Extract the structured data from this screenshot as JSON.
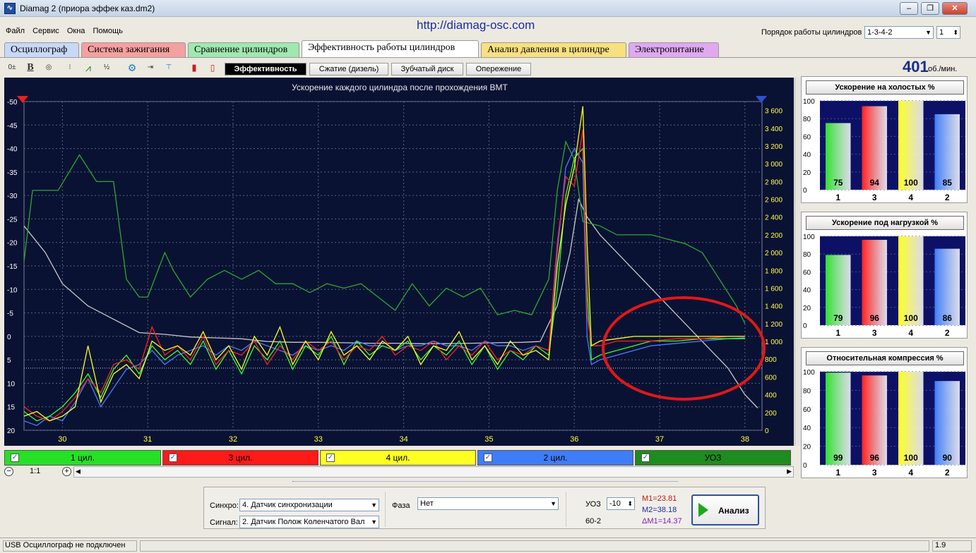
{
  "window": {
    "title": "Diamag 2 (приора эффек каз.dm2)",
    "url": "http://diamag-osc.com",
    "icon": "oscilloscope-app-icon"
  },
  "menu": [
    "Файл",
    "Сервис",
    "Окна",
    "Помощь"
  ],
  "firing_order": {
    "label": "Порядок работы цилиндров",
    "value": "1-3-4-2",
    "spin_value": "1"
  },
  "tabs": [
    {
      "label": "Осциллограф",
      "color": "#c8d8f8"
    },
    {
      "label": "Система зажигания",
      "color": "#f5a0a0"
    },
    {
      "label": "Сравнение цилиндров",
      "color": "#a0e8b0"
    },
    {
      "label": "Эффективность работы цилиндров",
      "color": "#ffffff",
      "active": true
    },
    {
      "label": "Анализ давления в цилиндре",
      "color": "#f8e080"
    },
    {
      "label": "Электропитание",
      "color": "#e0a8f0"
    }
  ],
  "subtabs": [
    "Эффективность",
    "Сжатие (дизель)",
    "Зубчатый диск",
    "Опережение"
  ],
  "rpm": {
    "value": "401",
    "unit": "об./мин."
  },
  "chart_data": {
    "type": "line",
    "title": "Ускорение каждого цилиндра после прохождения ВМТ",
    "x_ticks": [
      "30",
      "31",
      "32",
      "33",
      "34",
      "35",
      "36",
      "37",
      "38"
    ],
    "xlim": [
      29.55,
      38.2
    ],
    "left_ticks": [
      "-50",
      "-45",
      "-40",
      "-35",
      "-30",
      "-25",
      "-20",
      "-15",
      "-10",
      "-5",
      "0",
      "5",
      "10",
      "15",
      "20"
    ],
    "ylim_left": [
      -50,
      20
    ],
    "right_ticks": [
      "3 600",
      "3 400",
      "3 200",
      "3 000",
      "2 800",
      "2 600",
      "2 400",
      "2 200",
      "2 000",
      "1 800",
      "1 600",
      "1 400",
      "1 200",
      "1 000",
      "800",
      "600",
      "400",
      "200",
      "0"
    ],
    "ylim_right": [
      0,
      3700
    ],
    "series": [
      {
        "name": "1 цил.",
        "color": "#33ff33",
        "x": [
          29.55,
          29.7,
          29.85,
          30.0,
          30.15,
          30.3,
          30.45,
          30.6,
          30.75,
          30.9,
          31.05,
          31.2,
          31.35,
          31.5,
          31.65,
          31.8,
          31.95,
          32.1,
          32.25,
          32.4,
          32.55,
          32.7,
          32.85,
          33.0,
          33.15,
          33.3,
          33.45,
          33.6,
          33.75,
          33.9,
          34.05,
          34.2,
          34.35,
          34.5,
          34.65,
          34.8,
          34.95,
          35.1,
          35.25,
          35.4,
          35.55,
          35.7,
          35.8,
          35.9,
          36.0,
          36.1,
          36.15,
          36.2,
          36.3,
          36.5,
          36.7,
          36.9,
          37.2,
          37.5,
          37.8,
          38.0
        ],
        "y": [
          16,
          18,
          17,
          15,
          12,
          8,
          13,
          7,
          4,
          8,
          2,
          5,
          3,
          6,
          1,
          7,
          3,
          8,
          2,
          5,
          1,
          7,
          2,
          4,
          0,
          6,
          1,
          4,
          2,
          3,
          1,
          5,
          2,
          4,
          1,
          6,
          2,
          7,
          3,
          5,
          2,
          4,
          -10,
          -30,
          -38,
          -40,
          -10,
          5,
          4,
          3,
          2,
          1,
          1,
          0.5,
          0.5,
          0.5
        ]
      },
      {
        "name": "3 цил.",
        "color": "#ff2020",
        "x": [
          29.55,
          29.7,
          29.85,
          30.0,
          30.15,
          30.3,
          30.45,
          30.6,
          30.75,
          30.9,
          31.05,
          31.2,
          31.35,
          31.5,
          31.65,
          31.8,
          31.95,
          32.1,
          32.25,
          32.4,
          32.55,
          32.7,
          32.85,
          33.0,
          33.15,
          33.3,
          33.45,
          33.6,
          33.75,
          33.9,
          34.05,
          34.2,
          34.35,
          34.5,
          34.65,
          34.8,
          34.95,
          35.1,
          35.25,
          35.4,
          35.55,
          35.7,
          35.8,
          35.9,
          36.0,
          36.1,
          36.15,
          36.2,
          36.3,
          36.5,
          36.7,
          36.9,
          37.2,
          37.5,
          37.8,
          38.0
        ],
        "y": [
          15,
          17,
          18,
          16,
          13,
          9,
          12,
          6,
          5,
          7,
          -2,
          4,
          2,
          5,
          0,
          6,
          3,
          4,
          1,
          6,
          2,
          5,
          1,
          3,
          1,
          5,
          2,
          3,
          0,
          4,
          2,
          3,
          1,
          5,
          2,
          4,
          1,
          5,
          3,
          4,
          2,
          3,
          -20,
          -34,
          -32,
          -44,
          -5,
          2,
          2,
          1,
          1,
          1,
          0.5,
          0.5,
          0,
          0
        ]
      },
      {
        "name": "4 цил.",
        "color": "#ffff20",
        "x": [
          29.55,
          29.7,
          29.85,
          30.0,
          30.15,
          30.3,
          30.45,
          30.6,
          30.75,
          30.9,
          31.05,
          31.2,
          31.35,
          31.5,
          31.65,
          31.8,
          31.95,
          32.1,
          32.25,
          32.4,
          32.55,
          32.7,
          32.85,
          33.0,
          33.15,
          33.3,
          33.45,
          33.6,
          33.75,
          33.9,
          34.05,
          34.2,
          34.35,
          34.5,
          34.65,
          34.8,
          34.95,
          35.1,
          35.25,
          35.4,
          35.55,
          35.7,
          35.8,
          35.9,
          36.0,
          36.1,
          36.15,
          36.2,
          36.3,
          36.5,
          36.7,
          36.9,
          37.2,
          37.5,
          37.8,
          38.0
        ],
        "y": [
          17,
          16,
          18,
          17,
          15,
          2,
          14,
          8,
          6,
          9,
          1,
          3,
          2,
          4,
          -1,
          5,
          2,
          7,
          0,
          4,
          -2,
          6,
          1,
          5,
          -1,
          4,
          2,
          5,
          1,
          3,
          0,
          6,
          2,
          3,
          -1,
          5,
          2,
          6,
          1,
          4,
          3,
          5,
          -15,
          -28,
          -36,
          -49,
          -20,
          2,
          1,
          0.5,
          0,
          0,
          0,
          0,
          0,
          0
        ]
      },
      {
        "name": "2 цил.",
        "color": "#4a7cff",
        "x": [
          29.55,
          29.7,
          29.85,
          30.0,
          30.15,
          30.3,
          30.45,
          30.6,
          30.75,
          30.9,
          31.05,
          31.2,
          31.35,
          31.5,
          31.65,
          31.8,
          31.95,
          32.1,
          32.25,
          32.4,
          32.55,
          32.7,
          32.85,
          33.0,
          33.15,
          33.3,
          33.45,
          33.6,
          33.75,
          33.9,
          34.05,
          34.2,
          34.35,
          34.5,
          34.65,
          34.8,
          34.95,
          35.1,
          35.25,
          35.4,
          35.55,
          35.7,
          35.8,
          35.9,
          36.0,
          36.1,
          36.15,
          36.2,
          36.3,
          36.5,
          36.7,
          36.9,
          37.2,
          37.5,
          37.8,
          38.0
        ],
        "y": [
          18,
          19,
          17,
          18,
          14,
          9,
          15,
          11,
          7,
          6,
          3,
          6,
          4,
          3,
          2,
          4,
          2,
          3,
          1,
          2,
          3,
          4,
          2,
          3,
          2,
          3,
          1,
          2,
          2,
          3,
          2,
          2,
          1,
          2,
          2,
          3,
          1,
          2,
          2,
          3,
          2,
          3,
          -18,
          -36,
          -40,
          -37,
          0,
          6,
          5,
          4,
          3,
          2,
          1.5,
          1,
          0.5,
          0.3
        ]
      },
      {
        "name": "УОЗ",
        "color": "#2ea82e",
        "x": [
          29.55,
          29.65,
          29.9,
          29.95,
          30.2,
          30.4,
          30.6,
          30.75,
          30.9,
          31.0,
          31.2,
          31.3,
          31.5,
          31.7,
          31.9,
          32.1,
          32.3,
          32.5,
          32.7,
          32.9,
          33.1,
          33.3,
          33.5,
          33.7,
          33.9,
          34.1,
          34.3,
          34.5,
          34.7,
          34.9,
          35.1,
          35.3,
          35.5,
          35.6,
          35.7,
          35.8,
          35.9,
          36.0,
          36.1,
          36.3,
          36.5,
          36.7,
          36.9,
          37.1,
          37.3,
          37.5,
          37.7,
          37.9,
          38.0
        ],
        "y": [
          1900,
          2700,
          2700,
          2700,
          3100,
          2800,
          2800,
          1700,
          1500,
          1500,
          2000,
          1800,
          1500,
          1700,
          1800,
          1700,
          1800,
          1650,
          1650,
          1550,
          1650,
          1600,
          1650,
          1500,
          1350,
          1650,
          1400,
          1600,
          1500,
          1600,
          1300,
          1350,
          1300,
          1500,
          1700,
          2700,
          3250,
          3050,
          2350,
          2300,
          2200,
          2200,
          2200,
          2150,
          2100,
          2000,
          1700,
          1400,
          1200
        ]
      },
      {
        "name": "",
        "color": "#c8c8c8",
        "x": [
          29.55,
          29.8,
          30.0,
          30.3,
          30.6,
          30.9,
          31.2,
          31.5,
          31.8,
          32.1,
          32.4,
          32.7,
          33.0,
          33.3,
          33.6,
          33.9,
          34.2,
          34.5,
          34.8,
          35.1,
          35.4,
          35.6,
          35.8,
          35.95,
          36.05,
          36.15,
          36.3,
          36.6,
          36.9,
          37.2,
          37.5,
          37.8,
          38.0,
          38.15
        ],
        "y": [
          2300,
          2000,
          1650,
          1400,
          1250,
          1100,
          1080,
          1050,
          1040,
          1030,
          1000,
          990,
          990,
          985,
          980,
          980,
          975,
          975,
          980,
          985,
          990,
          1000,
          1400,
          2000,
          2600,
          2400,
          2200,
          1900,
          1600,
          1300,
          1000,
          700,
          400,
          250
        ]
      }
    ],
    "marker_line_right": 700
  },
  "legend": [
    {
      "label": "1 цил.",
      "color": "#26e026"
    },
    {
      "label": "3 цил.",
      "color": "#ff1a1a"
    },
    {
      "label": "4 цил.",
      "color": "#ffff22"
    },
    {
      "label": "2 цил.",
      "color": "#3f7cf7"
    },
    {
      "label": "УОЗ",
      "color": "#1e8c1e"
    }
  ],
  "zoom": {
    "label": "1:1"
  },
  "bar_panels": [
    {
      "title": "Ускорение на холостых %",
      "ticks": [
        "100",
        "80",
        "60",
        "40",
        "20",
        "0"
      ],
      "bars": [
        {
          "cyl": "1",
          "value": 75,
          "color": "#2ee02e"
        },
        {
          "cyl": "3",
          "value": 94,
          "color": "#ff2020"
        },
        {
          "cyl": "4",
          "value": 100,
          "color": "#ffff22"
        },
        {
          "cyl": "2",
          "value": 85,
          "color": "#3f7cf7"
        }
      ],
      "value_labels": true
    },
    {
      "title": "Ускорение под нагрузкой %",
      "ticks": [
        "100",
        "80",
        "60",
        "40",
        "20",
        "0"
      ],
      "bars": [
        {
          "cyl": "1",
          "value": 79,
          "color": "#2ee02e"
        },
        {
          "cyl": "3",
          "value": 96,
          "color": "#ff2020"
        },
        {
          "cyl": "4",
          "value": 100,
          "color": "#ffff22"
        },
        {
          "cyl": "2",
          "value": 86,
          "color": "#3f7cf7"
        }
      ],
      "value_labels": true
    },
    {
      "title": "Относительная компрессия %",
      "ticks": [
        "100",
        "80",
        "60",
        "40",
        "20",
        "0"
      ],
      "bars": [
        {
          "cyl": "1",
          "value": 99,
          "color": "#2ee02e"
        },
        {
          "cyl": "3",
          "value": 96,
          "color": "#ff2020"
        },
        {
          "cyl": "4",
          "value": 100,
          "color": "#ffff22"
        },
        {
          "cyl": "2",
          "value": 90,
          "color": "#3f7cf7"
        }
      ],
      "value_labels": true
    }
  ],
  "bottom": {
    "sync_label": "Синхро:",
    "sync_value": "4. Датчик синхронизации",
    "signal_label": "Сигнал:",
    "signal_value": "2. Датчик Полож Коленчатого Вал",
    "phase_label": "Фаза",
    "phase_value": "Нет",
    "uoz_label": "УОЗ",
    "uoz_value": "-10",
    "teeth": "60-2",
    "m1": "M1=23.81",
    "m2": "M2=38.18",
    "dm": "ΔM1=14.37",
    "analyze_label": "Анализ"
  },
  "status": {
    "left": "USB Осциллограф не подключен",
    "right": "1.9"
  }
}
